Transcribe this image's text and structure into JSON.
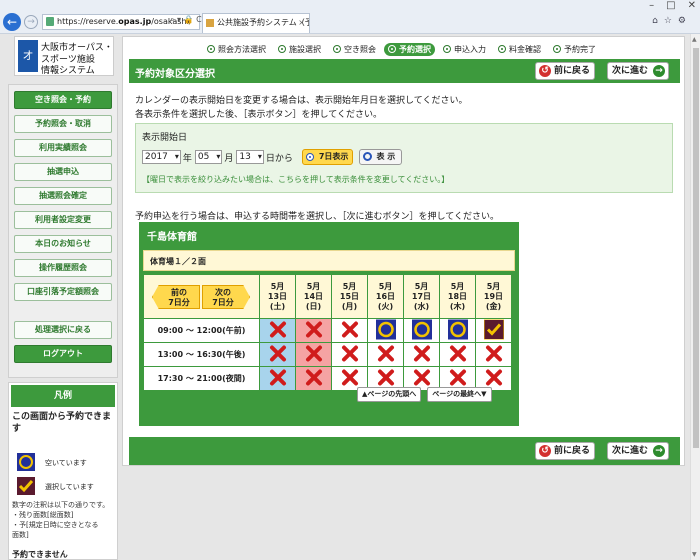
{
  "browser": {
    "url_prefix": "https://reserve.",
    "url_host": "opas.jp",
    "url_path": "/osakashi/",
    "url_tools": "⌕ ▾ 🔒 C",
    "tab_title": "公共施設予約システム（予...",
    "window_buttons": [
      "–",
      "□",
      "✕"
    ]
  },
  "logo": {
    "line1": "大阪市オーパス・",
    "line2": "スポーツ施設",
    "line3": "情報システム",
    "mark": "オ"
  },
  "sidebar": {
    "items": [
      {
        "label": "空き照会・予約",
        "state": "active"
      },
      {
        "label": "予約照会・取消"
      },
      {
        "label": "利用実績照会"
      },
      {
        "label": "抽選申込"
      },
      {
        "label": "抽選照会確定"
      },
      {
        "label": "利用者設定変更"
      },
      {
        "label": "本日のお知らせ"
      },
      {
        "label": "操作履歴照会"
      },
      {
        "label": "口座引落予定額照会"
      },
      {
        "label": "処理選択に戻る"
      },
      {
        "label": "ログアウト",
        "state": "dark"
      }
    ]
  },
  "legend": {
    "heading": "凡例",
    "can_reserve": "この画面から予約できます",
    "available": "空いています",
    "selected": "選択しています",
    "notes": [
      "数字の注釈は以下の通りです。",
      "・残り面数[総面数]",
      "・予[規定日時に空きとなる",
      "面数]"
    ],
    "cannot_reserve": "予約できません"
  },
  "steps": [
    {
      "label": "照会方法選択"
    },
    {
      "label": "施設選択"
    },
    {
      "label": "空き照会"
    },
    {
      "label": "予約選択",
      "current": true
    },
    {
      "label": "申込入力"
    },
    {
      "label": "料金確認"
    },
    {
      "label": "予約完了"
    }
  ],
  "panel": {
    "title": "予約対象区分選択",
    "back_label": "前に戻る",
    "next_label": "次に進む"
  },
  "instructions": {
    "line1": "カレンダーの表示開始日を変更する場合は、表示開始年月日を選択してください。",
    "line2": "各表示条件を選択した後、［表示ボタン］を押してください。",
    "line3": "予約申込を行う場合は、申込する時間帯を選択し、［次に進むボタン］を押してください。"
  },
  "date_filter": {
    "label": "表示開始日",
    "year": "2017",
    "year_unit": "年",
    "month": "05",
    "month_unit": "月",
    "day": "13",
    "day_unit": "日から",
    "seven_days_label": "7日表示",
    "show_label": "表 示",
    "hint": "【曜日で表示を絞り込みたい場合は、こちらを押して表示条件を変更してください。】"
  },
  "facility": {
    "name": "千島体育館",
    "room": "体育場１／２面",
    "prev_label_1": "前の",
    "prev_label_2": "7日分",
    "next_label_1": "次の",
    "next_label_2": "7日分",
    "days": [
      {
        "m": "5月",
        "d": "13日",
        "w": "(土)",
        "kind": "sat"
      },
      {
        "m": "5月",
        "d": "14日",
        "w": "(日)",
        "kind": "sun"
      },
      {
        "m": "5月",
        "d": "15日",
        "w": "(月)",
        "kind": ""
      },
      {
        "m": "5月",
        "d": "16日",
        "w": "(火)",
        "kind": ""
      },
      {
        "m": "5月",
        "d": "17日",
        "w": "(水)",
        "kind": ""
      },
      {
        "m": "5月",
        "d": "18日",
        "w": "(木)",
        "kind": ""
      },
      {
        "m": "5月",
        "d": "19日",
        "w": "(金)",
        "kind": ""
      }
    ],
    "slots": [
      {
        "time": "09:00 ～ 12:00(午前)",
        "status": [
          "x",
          "x",
          "x",
          "available",
          "available",
          "available",
          "selected"
        ]
      },
      {
        "time": "13:00 ～ 16:30(午後)",
        "status": [
          "x",
          "x",
          "x",
          "x",
          "x",
          "x",
          "x"
        ]
      },
      {
        "time": "17:30 ～ 21:00(夜間)",
        "status": [
          "x",
          "x",
          "x",
          "x",
          "x",
          "x",
          "x"
        ]
      }
    ],
    "page_top": "▲ページの先頭へ",
    "page_bottom": "ページの最終へ▼"
  },
  "colors": {
    "green": "#3d9a3d",
    "x_red": "#d01c1c",
    "sat": "#a8d4ec",
    "sun": "#f5a3a3"
  }
}
